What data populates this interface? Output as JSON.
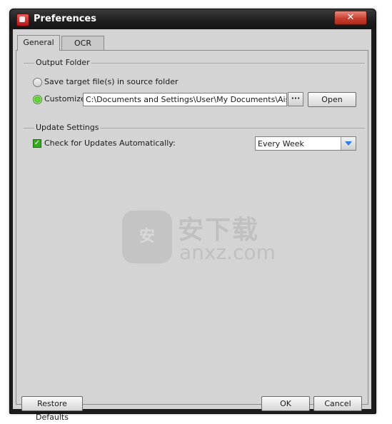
{
  "window": {
    "title": "Preferences",
    "close_symbol": "✕"
  },
  "tabs": [
    {
      "label": "General",
      "active": true
    },
    {
      "label": "OCR",
      "active": false
    }
  ],
  "output_folder": {
    "group_label": "Output Folder",
    "option_source": {
      "label": "Save target file(s) in source folder",
      "selected": false
    },
    "option_custom": {
      "label": "Customize:",
      "selected": true
    },
    "path_value": "C:\\Documents and Settings\\User\\My Documents\\Aiseesoft Studio",
    "browse_label": "···",
    "open_label": "Open"
  },
  "update_settings": {
    "group_label": "Update Settings",
    "check_updates_label": "Check for Updates Automatically:",
    "check_updates_checked": true,
    "check_mark": "✓",
    "frequency_value": "Every Week"
  },
  "watermark": {
    "chinese_text": "安下载",
    "domain_text": "anxz.com"
  },
  "footer": {
    "restore_label": "Restore Defaults",
    "ok_label": "OK",
    "cancel_label": "Cancel"
  },
  "colors": {
    "titlebar": "#1d1d1d",
    "dialog_bg": "#d4d4d4",
    "close_button": "#c9402f",
    "radio_checked": "#3fae1c",
    "dropdown_arrow": "#2a7de0"
  }
}
